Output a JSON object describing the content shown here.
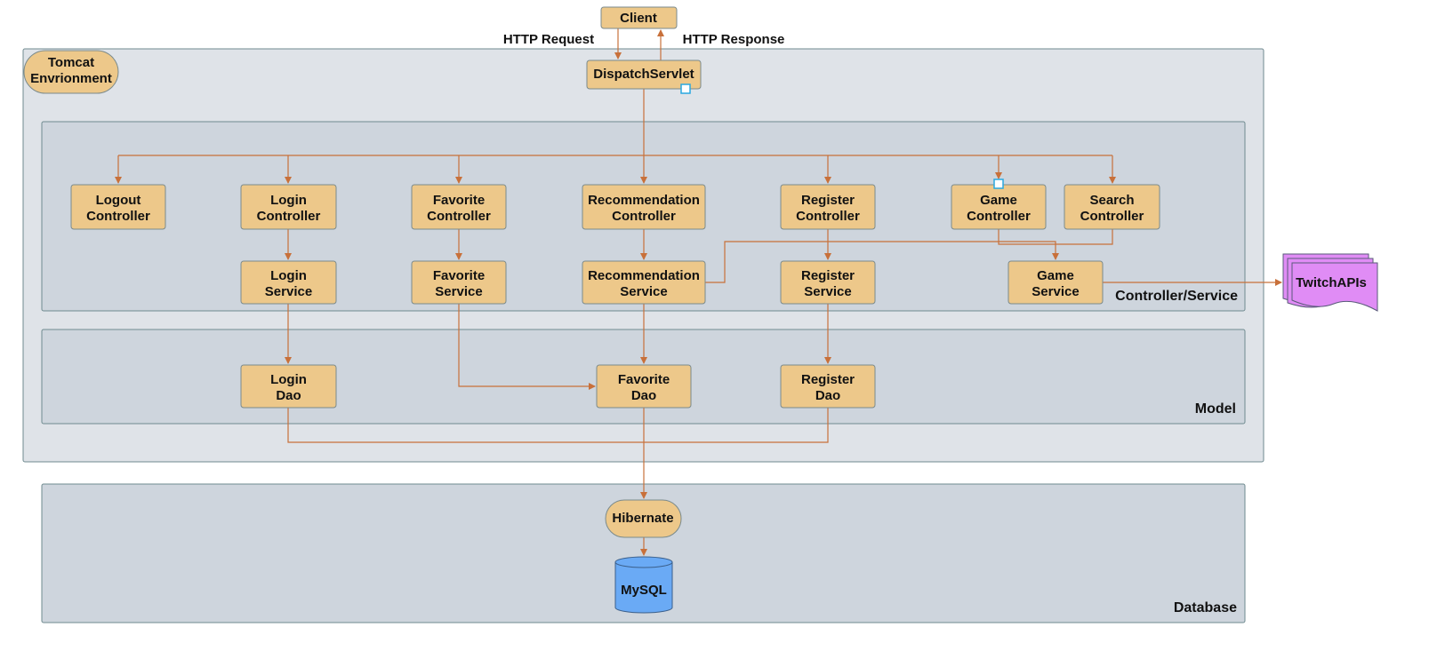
{
  "client": "Client",
  "http_request": "HTTP Request",
  "http_response": "HTTP Response",
  "dispatch": "DispatchServlet",
  "tomcat": [
    "Tomcat",
    "Envrionment"
  ],
  "panels": {
    "controller_service": "Controller/Service",
    "model": "Model",
    "database": "Database"
  },
  "controllers": {
    "logout": [
      "Logout",
      "Controller"
    ],
    "login": [
      "Login",
      "Controller"
    ],
    "favorite": [
      "Favorite",
      "Controller"
    ],
    "recommendation": [
      "Recommendation",
      "Controller"
    ],
    "register": [
      "Register",
      "Controller"
    ],
    "game": [
      "Game",
      "Controller"
    ],
    "search": [
      "Search",
      "Controller"
    ]
  },
  "services": {
    "login": [
      "Login",
      "Service"
    ],
    "favorite": [
      "Favorite",
      "Service"
    ],
    "recommendation": [
      "Recommendation",
      "Service"
    ],
    "register": [
      "Register",
      "Service"
    ],
    "game": [
      "Game",
      "Service"
    ]
  },
  "daos": {
    "login": [
      "Login",
      "Dao"
    ],
    "favorite": [
      "Favorite",
      "Dao"
    ],
    "register": [
      "Register",
      "Dao"
    ]
  },
  "hibernate": "Hibernate",
  "mysql": "MySQL",
  "twitch": "TwitchAPIs",
  "colors": {
    "box": "#edc88a",
    "arrow": "#c8703a",
    "panel": "#ced5dd",
    "outer": "#dfe3e8",
    "mysql": "#6aaaf5",
    "twitch": "#e08cf5"
  }
}
